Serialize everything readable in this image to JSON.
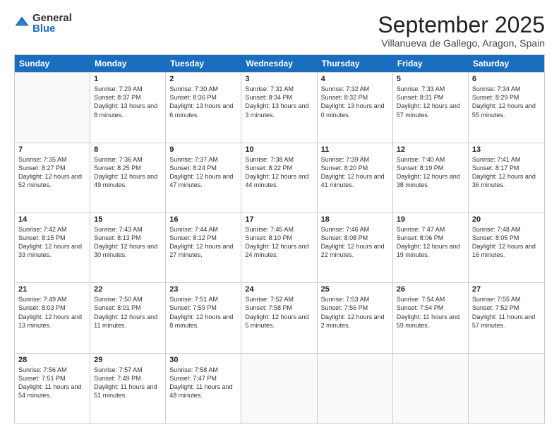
{
  "header": {
    "logo_general": "General",
    "logo_blue": "Blue",
    "month_title": "September 2025",
    "location": "Villanueva de Gallego, Aragon, Spain"
  },
  "weekdays": [
    "Sunday",
    "Monday",
    "Tuesday",
    "Wednesday",
    "Thursday",
    "Friday",
    "Saturday"
  ],
  "rows": [
    [
      {
        "day": "",
        "sunrise": "",
        "sunset": "",
        "daylight": ""
      },
      {
        "day": "1",
        "sunrise": "Sunrise: 7:29 AM",
        "sunset": "Sunset: 8:37 PM",
        "daylight": "Daylight: 13 hours and 8 minutes."
      },
      {
        "day": "2",
        "sunrise": "Sunrise: 7:30 AM",
        "sunset": "Sunset: 8:36 PM",
        "daylight": "Daylight: 13 hours and 6 minutes."
      },
      {
        "day": "3",
        "sunrise": "Sunrise: 7:31 AM",
        "sunset": "Sunset: 8:34 PM",
        "daylight": "Daylight: 13 hours and 3 minutes."
      },
      {
        "day": "4",
        "sunrise": "Sunrise: 7:32 AM",
        "sunset": "Sunset: 8:32 PM",
        "daylight": "Daylight: 13 hours and 0 minutes."
      },
      {
        "day": "5",
        "sunrise": "Sunrise: 7:33 AM",
        "sunset": "Sunset: 8:31 PM",
        "daylight": "Daylight: 12 hours and 57 minutes."
      },
      {
        "day": "6",
        "sunrise": "Sunrise: 7:34 AM",
        "sunset": "Sunset: 8:29 PM",
        "daylight": "Daylight: 12 hours and 55 minutes."
      }
    ],
    [
      {
        "day": "7",
        "sunrise": "Sunrise: 7:35 AM",
        "sunset": "Sunset: 8:27 PM",
        "daylight": "Daylight: 12 hours and 52 minutes."
      },
      {
        "day": "8",
        "sunrise": "Sunrise: 7:36 AM",
        "sunset": "Sunset: 8:25 PM",
        "daylight": "Daylight: 12 hours and 49 minutes."
      },
      {
        "day": "9",
        "sunrise": "Sunrise: 7:37 AM",
        "sunset": "Sunset: 8:24 PM",
        "daylight": "Daylight: 12 hours and 47 minutes."
      },
      {
        "day": "10",
        "sunrise": "Sunrise: 7:38 AM",
        "sunset": "Sunset: 8:22 PM",
        "daylight": "Daylight: 12 hours and 44 minutes."
      },
      {
        "day": "11",
        "sunrise": "Sunrise: 7:39 AM",
        "sunset": "Sunset: 8:20 PM",
        "daylight": "Daylight: 12 hours and 41 minutes."
      },
      {
        "day": "12",
        "sunrise": "Sunrise: 7:40 AM",
        "sunset": "Sunset: 8:19 PM",
        "daylight": "Daylight: 12 hours and 38 minutes."
      },
      {
        "day": "13",
        "sunrise": "Sunrise: 7:41 AM",
        "sunset": "Sunset: 8:17 PM",
        "daylight": "Daylight: 12 hours and 36 minutes."
      }
    ],
    [
      {
        "day": "14",
        "sunrise": "Sunrise: 7:42 AM",
        "sunset": "Sunset: 8:15 PM",
        "daylight": "Daylight: 12 hours and 33 minutes."
      },
      {
        "day": "15",
        "sunrise": "Sunrise: 7:43 AM",
        "sunset": "Sunset: 8:13 PM",
        "daylight": "Daylight: 12 hours and 30 minutes."
      },
      {
        "day": "16",
        "sunrise": "Sunrise: 7:44 AM",
        "sunset": "Sunset: 8:12 PM",
        "daylight": "Daylight: 12 hours and 27 minutes."
      },
      {
        "day": "17",
        "sunrise": "Sunrise: 7:45 AM",
        "sunset": "Sunset: 8:10 PM",
        "daylight": "Daylight: 12 hours and 24 minutes."
      },
      {
        "day": "18",
        "sunrise": "Sunrise: 7:46 AM",
        "sunset": "Sunset: 8:08 PM",
        "daylight": "Daylight: 12 hours and 22 minutes."
      },
      {
        "day": "19",
        "sunrise": "Sunrise: 7:47 AM",
        "sunset": "Sunset: 8:06 PM",
        "daylight": "Daylight: 12 hours and 19 minutes."
      },
      {
        "day": "20",
        "sunrise": "Sunrise: 7:48 AM",
        "sunset": "Sunset: 8:05 PM",
        "daylight": "Daylight: 12 hours and 16 minutes."
      }
    ],
    [
      {
        "day": "21",
        "sunrise": "Sunrise: 7:49 AM",
        "sunset": "Sunset: 8:03 PM",
        "daylight": "Daylight: 12 hours and 13 minutes."
      },
      {
        "day": "22",
        "sunrise": "Sunrise: 7:50 AM",
        "sunset": "Sunset: 8:01 PM",
        "daylight": "Daylight: 12 hours and 11 minutes."
      },
      {
        "day": "23",
        "sunrise": "Sunrise: 7:51 AM",
        "sunset": "Sunset: 7:59 PM",
        "daylight": "Daylight: 12 hours and 8 minutes."
      },
      {
        "day": "24",
        "sunrise": "Sunrise: 7:52 AM",
        "sunset": "Sunset: 7:58 PM",
        "daylight": "Daylight: 12 hours and 5 minutes."
      },
      {
        "day": "25",
        "sunrise": "Sunrise: 7:53 AM",
        "sunset": "Sunset: 7:56 PM",
        "daylight": "Daylight: 12 hours and 2 minutes."
      },
      {
        "day": "26",
        "sunrise": "Sunrise: 7:54 AM",
        "sunset": "Sunset: 7:54 PM",
        "daylight": "Daylight: 11 hours and 59 minutes."
      },
      {
        "day": "27",
        "sunrise": "Sunrise: 7:55 AM",
        "sunset": "Sunset: 7:52 PM",
        "daylight": "Daylight: 11 hours and 57 minutes."
      }
    ],
    [
      {
        "day": "28",
        "sunrise": "Sunrise: 7:56 AM",
        "sunset": "Sunset: 7:51 PM",
        "daylight": "Daylight: 11 hours and 54 minutes."
      },
      {
        "day": "29",
        "sunrise": "Sunrise: 7:57 AM",
        "sunset": "Sunset: 7:49 PM",
        "daylight": "Daylight: 11 hours and 51 minutes."
      },
      {
        "day": "30",
        "sunrise": "Sunrise: 7:58 AM",
        "sunset": "Sunset: 7:47 PM",
        "daylight": "Daylight: 11 hours and 48 minutes."
      },
      {
        "day": "",
        "sunrise": "",
        "sunset": "",
        "daylight": ""
      },
      {
        "day": "",
        "sunrise": "",
        "sunset": "",
        "daylight": ""
      },
      {
        "day": "",
        "sunrise": "",
        "sunset": "",
        "daylight": ""
      },
      {
        "day": "",
        "sunrise": "",
        "sunset": "",
        "daylight": ""
      }
    ]
  ]
}
